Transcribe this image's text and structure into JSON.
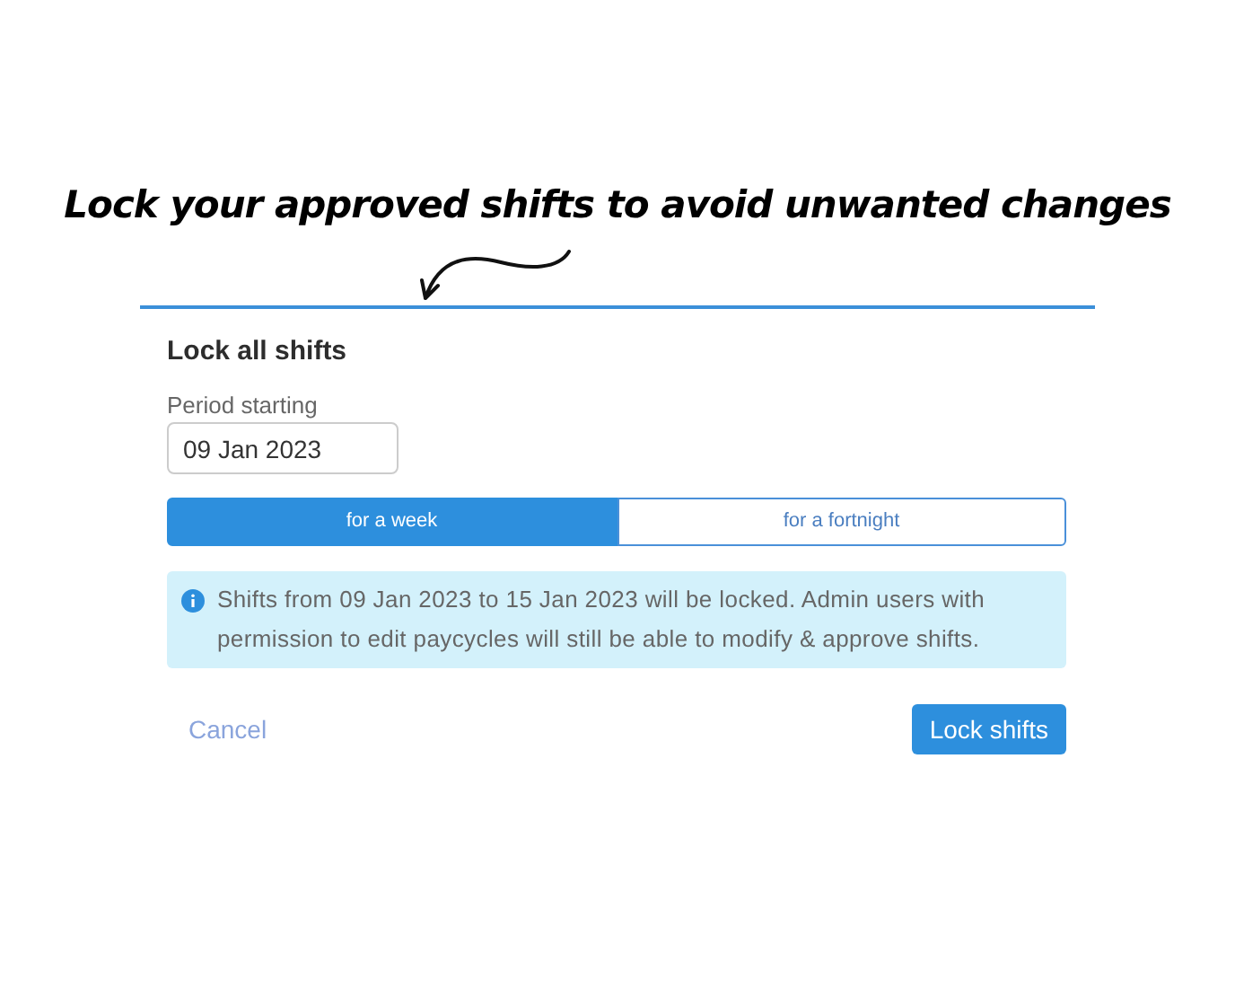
{
  "annotation": {
    "caption": "Lock your approved shifts to avoid unwanted changes"
  },
  "dialog": {
    "title": "Lock all shifts",
    "period": {
      "label": "Period starting",
      "value": "09 Jan 2023"
    },
    "durations": [
      {
        "label": "for a week",
        "selected": true
      },
      {
        "label": "for a fortnight",
        "selected": false
      }
    ],
    "info": "Shifts from 09 Jan 2023 to 15 Jan 2023 will be locked. Admin users with permission to edit paycycles will still be able to modify & approve shifts.",
    "cancel": "Cancel",
    "confirm": "Lock shifts"
  }
}
